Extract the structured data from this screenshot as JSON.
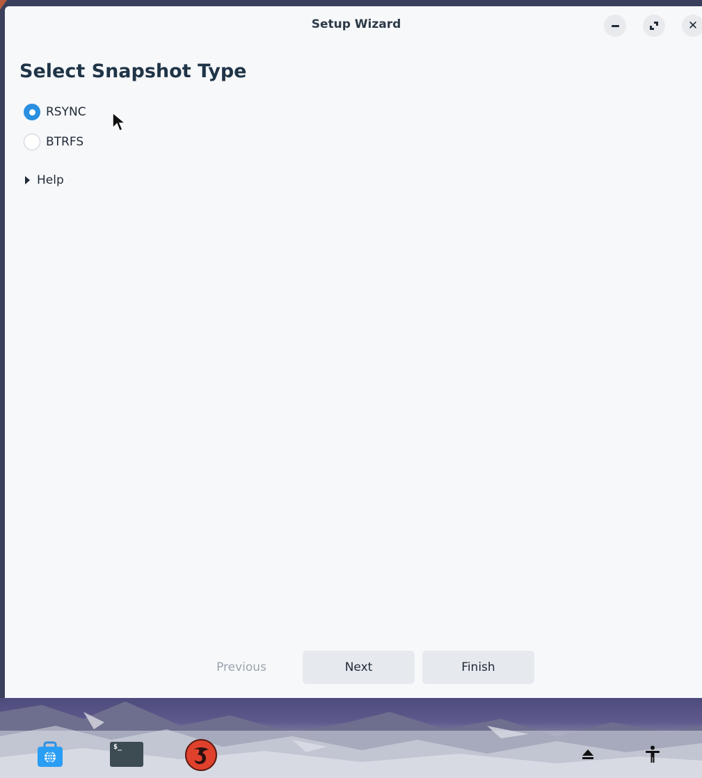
{
  "window": {
    "title": "Setup Wizard",
    "controls": [
      "minimize-icon",
      "maximize-icon",
      "close-icon"
    ]
  },
  "page": {
    "heading": "Select Snapshot Type",
    "options": [
      {
        "label": "RSYNC",
        "selected": true
      },
      {
        "label": "BTRFS",
        "selected": false
      }
    ],
    "help_label": "Help"
  },
  "buttons": {
    "previous": "Previous",
    "next": "Next",
    "finish": "Finish"
  },
  "dock": {
    "left_items": [
      "browser-store-icon",
      "terminal-icon",
      "timeshift-icon"
    ],
    "terminal_prompt": "$_",
    "right_items": [
      "eject-icon",
      "accessibility-icon"
    ]
  },
  "colors": {
    "accent": "#2a8fe0",
    "heading": "#1f3447",
    "window_bg": "#f7f8fa",
    "button_bg": "#e6e9ee",
    "disabled_text": "#9aa3ad",
    "timeshift_red": "#e0412d"
  }
}
